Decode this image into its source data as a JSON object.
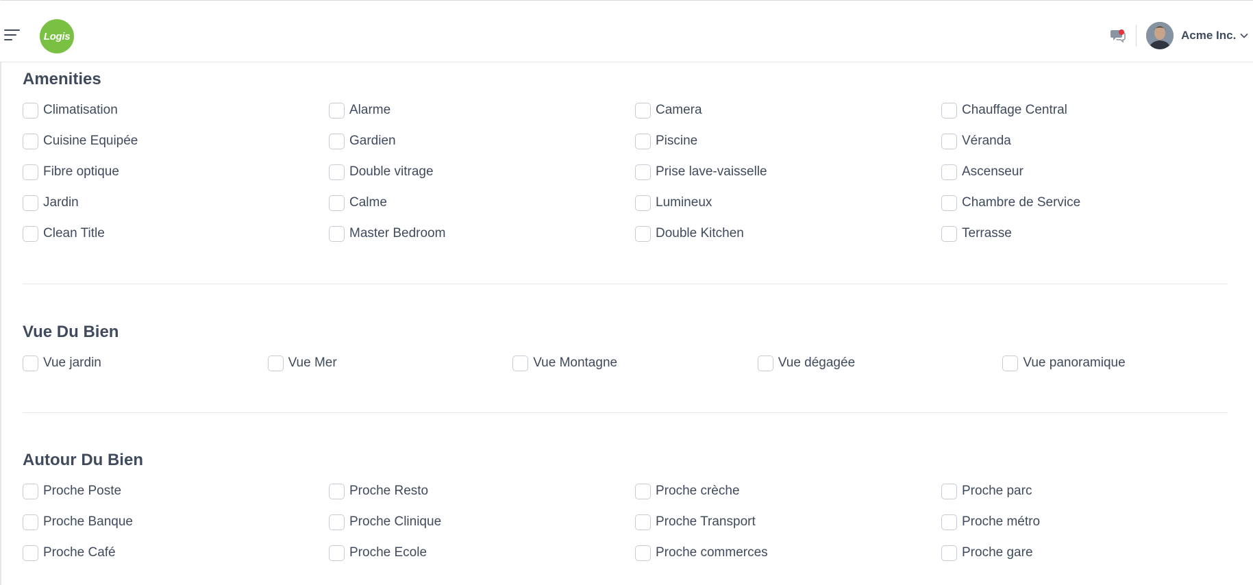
{
  "header": {
    "logo_text": "Logis",
    "user_name": "Acme Inc.",
    "icons": {
      "menu": "hamburger-menu-icon",
      "notifications": "chat-notification-icon",
      "dropdown": "chevron-down-icon"
    }
  },
  "colors": {
    "logo": "#7ac143",
    "notification_dot": "#e4313c",
    "text": "#3f4a5c"
  },
  "amenities": {
    "title": "Amenities",
    "options": [
      "Climatisation",
      "Alarme",
      "Camera",
      "Chauffage Central",
      "Cuisine Equipée",
      "Gardien",
      "Piscine",
      "Véranda",
      "Fibre optique",
      "Double vitrage",
      "Prise lave-vaisselle",
      "Ascenseur",
      "Jardin",
      "Calme",
      "Lumineux",
      "Chambre de Service",
      "Clean Title",
      "Master Bedroom",
      "Double Kitchen",
      "Terrasse"
    ]
  },
  "vue_du_bien": {
    "title": "Vue Du Bien",
    "options": [
      "Vue jardin",
      "Vue Mer",
      "Vue Montagne",
      "Vue dégagée",
      "Vue panoramique"
    ]
  },
  "autour_du_bien": {
    "title": "Autour Du Bien",
    "options": [
      "Proche Poste",
      "Proche Resto",
      "Proche crèche",
      "Proche parc",
      "Proche Banque",
      "Proche Clinique",
      "Proche Transport",
      "Proche métro",
      "Proche Café",
      "Proche Ecole",
      "Proche commerces",
      "Proche gare"
    ]
  }
}
